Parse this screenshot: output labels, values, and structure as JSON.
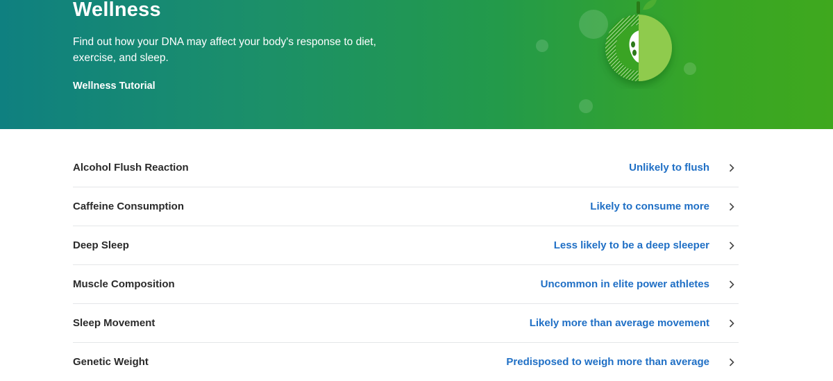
{
  "hero": {
    "title": "Wellness",
    "description": "Find out how your DNA may affect your body's response to diet, exercise, and sleep.",
    "tutorial_link": "Wellness Tutorial",
    "illustration": "apple-icon"
  },
  "reports": [
    {
      "label": "Alcohol Flush Reaction",
      "result": "Unlikely to flush"
    },
    {
      "label": "Caffeine Consumption",
      "result": "Likely to consume more"
    },
    {
      "label": "Deep Sleep",
      "result": "Less likely to be a deep sleeper"
    },
    {
      "label": "Muscle Composition",
      "result": "Uncommon in elite power athletes"
    },
    {
      "label": "Sleep Movement",
      "result": "Likely more than average movement"
    },
    {
      "label": "Genetic Weight",
      "result": "Predisposed to weigh more than average"
    }
  ],
  "colors": {
    "hero_gradient_start": "#0f8080",
    "hero_gradient_end": "#3fa81e",
    "result_link": "#1f6fc5",
    "apple_light": "#8fcb4e",
    "apple_dark": "#2e9a1f"
  }
}
